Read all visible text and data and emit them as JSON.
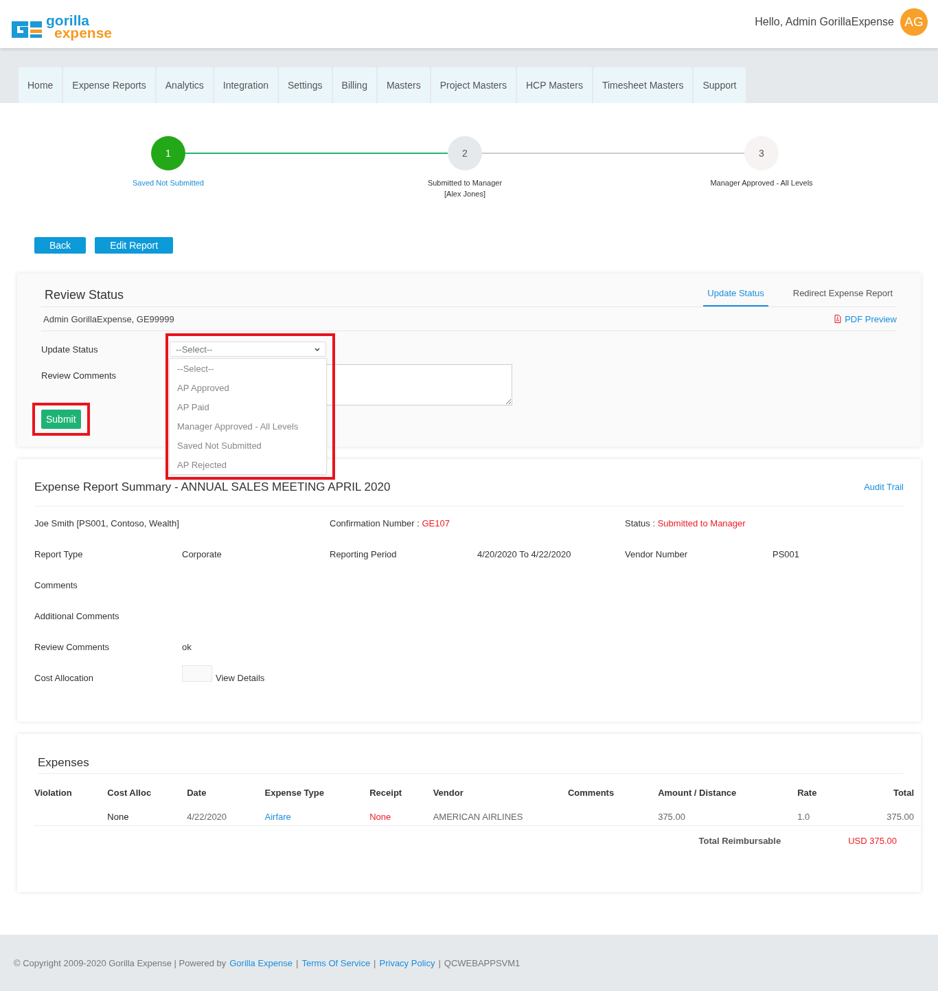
{
  "header": {
    "logo": {
      "word1": "gorilla",
      "word2": "expense"
    },
    "greeting": "Hello, Admin GorillaExpense",
    "avatar": "AG"
  },
  "nav": [
    {
      "label": "Home",
      "selected": false
    },
    {
      "label": "Expense Reports",
      "selected": false
    },
    {
      "label": "Analytics",
      "selected": false
    },
    {
      "label": "Integration",
      "selected": false
    },
    {
      "label": "Settings",
      "selected": false
    },
    {
      "label": "Billing",
      "selected": false
    },
    {
      "label": "Masters",
      "selected": false
    },
    {
      "label": "Project Masters",
      "selected": false
    },
    {
      "label": "HCP Masters",
      "selected": false
    },
    {
      "label": "Timesheet Masters",
      "selected": false
    },
    {
      "label": "Support",
      "selected": false
    }
  ],
  "stepper": [
    {
      "number": "1",
      "label": [
        "Saved Not Submitted"
      ],
      "done": true,
      "current": false
    },
    {
      "number": "2",
      "label": [
        "Submitted to Manager",
        "[Alex Jones]"
      ],
      "done": false,
      "current": true
    },
    {
      "number": "3",
      "label": [
        "Manager Approved - All Levels"
      ],
      "done": false,
      "current": false
    }
  ],
  "actions": [
    "Back",
    "Edit Report"
  ],
  "review": {
    "title": "Review Status",
    "tabs": [
      {
        "label": "Update Status",
        "selected": true
      },
      {
        "label": "Redirect Expense Report",
        "selected": false
      }
    ],
    "reviewer": "Admin GorillaExpense, GE99999",
    "pdf_link": "PDF Preview",
    "status_label": "Update Status",
    "select_value": "--Select--",
    "dropdown_open": true,
    "options": [
      "--Select--",
      "AP Approved",
      "AP Paid",
      "Manager Approved - All Levels",
      "Saved Not Submitted",
      "AP Rejected"
    ],
    "comments_label": "Review Comments",
    "submit": "Submit",
    "dropdown_highlighted": true,
    "submit_highlighted": true
  },
  "summary": {
    "title": "Expense Report Summary - ANNUAL SALES MEETING APRIL 2020",
    "audit_link": "Audit Trail",
    "employee": "Joe Smith [PS001, Contoso, Wealth]",
    "confirmation_label": "Confirmation Number : ",
    "confirmation_value": "GE107",
    "status_label": "Status : ",
    "status_value": "Submitted to Manager",
    "fields": [
      [
        {
          "label": "Report Type",
          "value": "Corporate"
        },
        {
          "label": "Reporting Period",
          "value": "4/20/2020 To 4/22/2020"
        },
        {
          "label": "Vendor Number",
          "value": "PS001"
        }
      ],
      [
        {
          "label": "Comments"
        }
      ],
      [
        {
          "label": "Additional Comments"
        }
      ],
      [
        {
          "label": "Review Comments",
          "value": "ok"
        }
      ]
    ],
    "cost_allocation_label": "Cost Allocation",
    "cost_allocation_checked": false,
    "view_details": "View Details"
  },
  "expenses": {
    "title": "Expenses",
    "columns": [
      "Violation",
      "Cost Alloc",
      "Date",
      "Expense Type",
      "Receipt",
      "Vendor",
      "Comments",
      "Amount / Distance",
      "Rate",
      "Total"
    ],
    "rows": [
      {
        "violation": "",
        "cost_alloc": "None",
        "date": "4/22/2020",
        "expense_type": "Airfare",
        "receipt": "None",
        "vendor": "AMERICAN AIRLINES",
        "comments": "",
        "amount": "375.00",
        "rate": "1.0",
        "total": "375.00"
      }
    ],
    "total_label": "Total Reimbursable",
    "total_value": "USD 375.00"
  },
  "footer": [
    {
      "kind": "text",
      "text": "© Copyright 2009-2020 Gorilla Expense | Powered by"
    },
    {
      "kind": "link",
      "text": "Gorilla Expense"
    },
    {
      "kind": "sep",
      "text": "|"
    },
    {
      "kind": "link",
      "text": "Terms Of Service"
    },
    {
      "kind": "sep",
      "text": "|"
    },
    {
      "kind": "link",
      "text": "Privacy Policy"
    },
    {
      "kind": "sep",
      "text": "|"
    },
    {
      "kind": "text",
      "text": "QCWEBAPPSVM1"
    }
  ]
}
